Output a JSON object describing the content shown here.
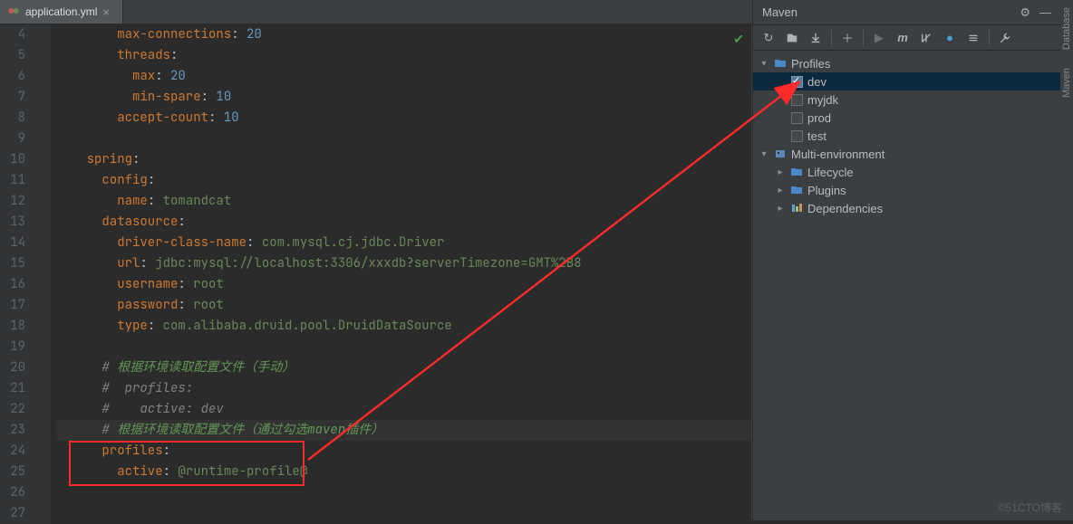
{
  "tab": {
    "filename": "application.yml"
  },
  "gutter_start": 4,
  "code": [
    {
      "indent": 4,
      "tokens": [
        {
          "t": "max-connections",
          "c": "k-key"
        },
        {
          "t": ": ",
          "c": ""
        },
        {
          "t": "20",
          "c": "k-num"
        }
      ]
    },
    {
      "indent": 4,
      "tokens": [
        {
          "t": "threads",
          "c": "k-key"
        },
        {
          "t": ":",
          "c": ""
        }
      ]
    },
    {
      "indent": 5,
      "tokens": [
        {
          "t": "max",
          "c": "k-key"
        },
        {
          "t": ": ",
          "c": ""
        },
        {
          "t": "20",
          "c": "k-num"
        }
      ]
    },
    {
      "indent": 5,
      "tokens": [
        {
          "t": "min-spare",
          "c": "k-key"
        },
        {
          "t": ": ",
          "c": ""
        },
        {
          "t": "10",
          "c": "k-num"
        }
      ]
    },
    {
      "indent": 4,
      "tokens": [
        {
          "t": "accept-count",
          "c": "k-key"
        },
        {
          "t": ": ",
          "c": ""
        },
        {
          "t": "10",
          "c": "k-num"
        }
      ]
    },
    {
      "indent": 0,
      "tokens": []
    },
    {
      "indent": 2,
      "tokens": [
        {
          "t": "spring",
          "c": "k-key"
        },
        {
          "t": ":",
          "c": ""
        }
      ]
    },
    {
      "indent": 3,
      "tokens": [
        {
          "t": "config",
          "c": "k-key"
        },
        {
          "t": ":",
          "c": ""
        }
      ]
    },
    {
      "indent": 4,
      "tokens": [
        {
          "t": "name",
          "c": "k-key"
        },
        {
          "t": ": ",
          "c": ""
        },
        {
          "t": "tomandcat",
          "c": "k-str"
        }
      ]
    },
    {
      "indent": 3,
      "tokens": [
        {
          "t": "datasource",
          "c": "k-key"
        },
        {
          "t": ":",
          "c": ""
        }
      ]
    },
    {
      "indent": 4,
      "tokens": [
        {
          "t": "driver-class-name",
          "c": "k-key"
        },
        {
          "t": ": ",
          "c": ""
        },
        {
          "t": "com.mysql.cj.jdbc.Driver",
          "c": "k-str"
        }
      ]
    },
    {
      "indent": 4,
      "tokens": [
        {
          "t": "url",
          "c": "k-key"
        },
        {
          "t": ": ",
          "c": ""
        },
        {
          "t": "jdbc:mysql://localhost:3306/xxxdb?serverTimezone=GMT%2B8",
          "c": "k-str"
        }
      ]
    },
    {
      "indent": 4,
      "tokens": [
        {
          "t": "username",
          "c": "k-key"
        },
        {
          "t": ": ",
          "c": ""
        },
        {
          "t": "root",
          "c": "k-str"
        }
      ]
    },
    {
      "indent": 4,
      "tokens": [
        {
          "t": "password",
          "c": "k-key"
        },
        {
          "t": ": ",
          "c": ""
        },
        {
          "t": "root",
          "c": "k-str"
        }
      ]
    },
    {
      "indent": 4,
      "tokens": [
        {
          "t": "type",
          "c": "k-key"
        },
        {
          "t": ": ",
          "c": ""
        },
        {
          "t": "com.alibaba.druid.pool.DruidDataSource",
          "c": "k-str"
        }
      ]
    },
    {
      "indent": 0,
      "tokens": []
    },
    {
      "indent": 3,
      "tokens": [
        {
          "t": "# ",
          "c": "k-comment"
        },
        {
          "t": "根据环境读取配置文件（手动）",
          "c": "k-cj"
        }
      ]
    },
    {
      "indent": 3,
      "tokens": [
        {
          "t": "#  profiles:",
          "c": "k-comment"
        }
      ]
    },
    {
      "indent": 3,
      "tokens": [
        {
          "t": "#    active: dev",
          "c": "k-comment"
        }
      ]
    },
    {
      "indent": 3,
      "tokens": [
        {
          "t": "# ",
          "c": "k-comment"
        },
        {
          "t": "根据环境读取配置文件（通过勾选maven插件）",
          "c": "k-cj"
        }
      ],
      "hl": true
    },
    {
      "indent": 3,
      "tokens": [
        {
          "t": "profiles",
          "c": "k-key"
        },
        {
          "t": ":",
          "c": ""
        }
      ]
    },
    {
      "indent": 4,
      "tokens": [
        {
          "t": "active",
          "c": "k-key"
        },
        {
          "t": ": ",
          "c": ""
        },
        {
          "t": "@runtime-profile@",
          "c": "k-str"
        }
      ]
    },
    {
      "indent": 0,
      "tokens": []
    },
    {
      "indent": 0,
      "tokens": []
    }
  ],
  "maven": {
    "title": "Maven",
    "profiles_label": "Profiles",
    "profiles": [
      {
        "name": "dev",
        "checked": true,
        "selected": true
      },
      {
        "name": "myjdk",
        "checked": false
      },
      {
        "name": "prod",
        "checked": false
      },
      {
        "name": "test",
        "checked": false
      }
    ],
    "project_label": "Multi-environment",
    "project_children": [
      {
        "name": "Lifecycle",
        "icon": "folder"
      },
      {
        "name": "Plugins",
        "icon": "folder"
      },
      {
        "name": "Dependencies",
        "icon": "bars"
      }
    ]
  },
  "sidebar_right": [
    "Database",
    "Maven"
  ],
  "watermark": "©51CTO博客"
}
